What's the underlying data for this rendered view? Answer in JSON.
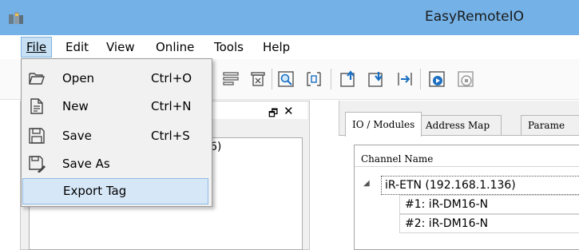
{
  "window": {
    "title": "EasyRemoteIO"
  },
  "menubar": {
    "items": [
      {
        "label": "File"
      },
      {
        "label": "Edit"
      },
      {
        "label": "View"
      },
      {
        "label": "Online"
      },
      {
        "label": "Tools"
      },
      {
        "label": "Help"
      }
    ]
  },
  "file_menu": {
    "items": [
      {
        "label": "Open",
        "shortcut": "Ctrl+O",
        "icon": "open-folder-icon"
      },
      {
        "label": "New",
        "shortcut": "Ctrl+N",
        "icon": "new-document-icon"
      },
      {
        "label": "Save",
        "shortcut": "Ctrl+S",
        "icon": "save-disk-icon"
      },
      {
        "label": "Save As",
        "shortcut": "",
        "icon": "save-as-icon"
      },
      {
        "label": "Export Tag",
        "shortcut": "",
        "icon": ""
      }
    ],
    "highlighted": "Export Tag"
  },
  "left_panel": {
    "partial_text": "6)"
  },
  "right_panel": {
    "tabs": [
      {
        "label": "IO / Modules"
      },
      {
        "label": "Address Map"
      },
      {
        "label": "Parame"
      }
    ],
    "active_tab": "IO / Modules",
    "column_header": "Channel Name",
    "tree": [
      {
        "label": "iR-ETN (192.168.1.136)"
      },
      {
        "label": "#1: iR-DM16-N"
      },
      {
        "label": "#2: iR-DM16-N"
      }
    ]
  },
  "colors": {
    "titlebar": "#74b1e6",
    "menu_highlight": "#c7e0f4",
    "selection": "#d6e7f7"
  }
}
